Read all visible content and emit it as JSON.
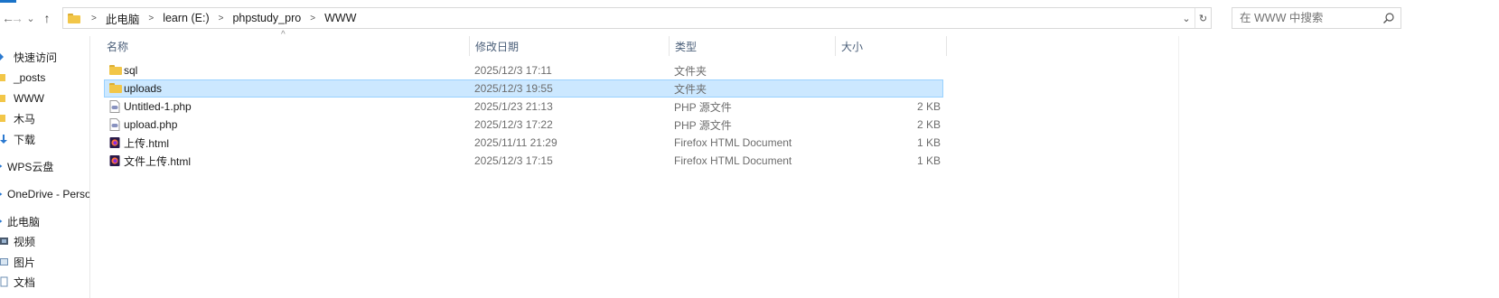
{
  "nav": {
    "back": "←",
    "forward": "→",
    "recent": "⌄",
    "up": "↑"
  },
  "address": {
    "crumbs": [
      "此电脑",
      "learn (E:)",
      "phpstudy_pro",
      "WWW"
    ],
    "dropdown": "⌄",
    "refresh": "↻"
  },
  "search": {
    "placeholder": "在 WWW 中搜索",
    "icon": "search-icon"
  },
  "sidebar": {
    "items": [
      {
        "label": "快速访问",
        "icon": "star-icon"
      },
      {
        "label": "_posts",
        "icon": "folder-icon"
      },
      {
        "label": "WWW",
        "icon": "folder-icon"
      },
      {
        "label": "木马",
        "icon": "folder-icon"
      },
      {
        "label": "下载",
        "icon": "download-icon"
      },
      {
        "label": "WPS云盘",
        "icon": "cloud-icon"
      },
      {
        "label": "OneDrive - Perso",
        "icon": "cloud-icon"
      },
      {
        "label": "此电脑",
        "icon": "computer-icon"
      },
      {
        "label": "视频",
        "icon": "video-icon"
      },
      {
        "label": "图片",
        "icon": "picture-icon"
      },
      {
        "label": "文档",
        "icon": "document-icon"
      }
    ]
  },
  "columns": {
    "name": "名称",
    "date": "修改日期",
    "type": "类型",
    "size": "大小",
    "sort_indicator": "^"
  },
  "files": [
    {
      "name": "sql",
      "date": "2025/12/3 17:11",
      "type": "文件夹",
      "size": "",
      "icon": "folder-icon",
      "selected": false
    },
    {
      "name": "uploads",
      "date": "2025/12/3 19:55",
      "type": "文件夹",
      "size": "",
      "icon": "folder-icon",
      "selected": true
    },
    {
      "name": "Untitled-1.php",
      "date": "2025/1/23 21:13",
      "type": "PHP 源文件",
      "size": "2 KB",
      "icon": "php-file-icon",
      "selected": false
    },
    {
      "name": "upload.php",
      "date": "2025/12/3 17:22",
      "type": "PHP 源文件",
      "size": "2 KB",
      "icon": "php-file-icon",
      "selected": false
    },
    {
      "name": "上传.html",
      "date": "2025/11/11 21:29",
      "type": "Firefox HTML Document",
      "size": "1 KB",
      "icon": "firefox-html-icon",
      "selected": false
    },
    {
      "name": "文件上传.html",
      "date": "2025/12/3 17:15",
      "type": "Firefox HTML Document",
      "size": "1 KB",
      "icon": "firefox-html-icon",
      "selected": false
    }
  ],
  "colors": {
    "selection": "#cce8ff",
    "selection_border": "#99d1ff",
    "folder": "#f2c648",
    "header_text": "#4c607a"
  }
}
